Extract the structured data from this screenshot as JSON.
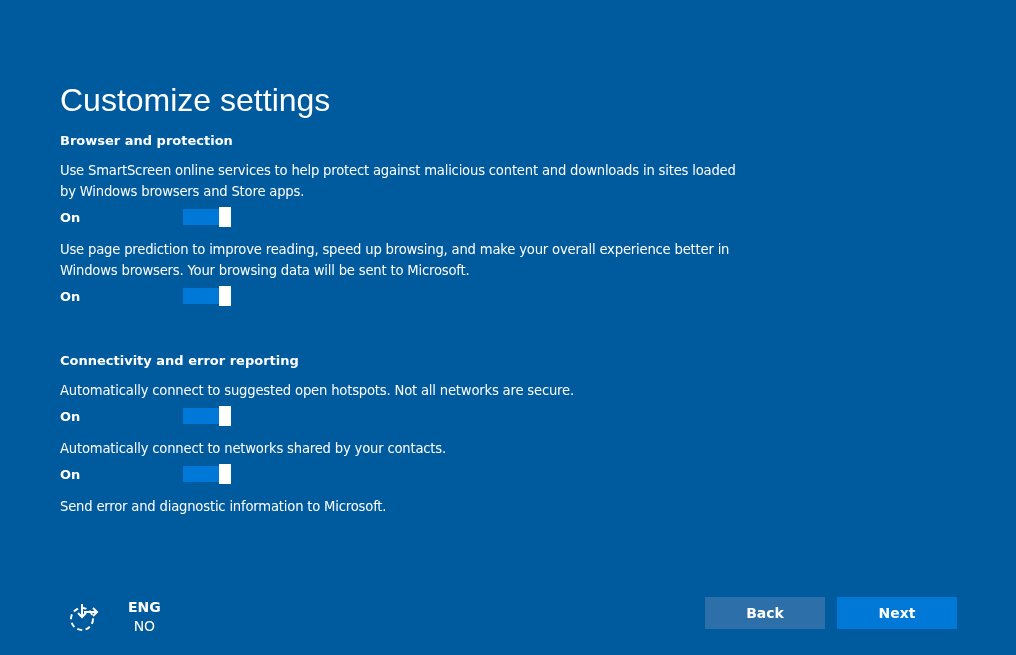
{
  "title": "Customize settings",
  "sections": [
    {
      "heading": "Browser and protection",
      "items": [
        {
          "kind": "toggle",
          "description": "Use SmartScreen online services to help protect against malicious content and downloads in sites loaded by Windows browsers and Store apps.",
          "state_label": "On",
          "on": true
        },
        {
          "kind": "toggle",
          "description": "Use page prediction to improve reading, speed up browsing, and make your overall experience better in Windows browsers. Your browsing data will be sent to Microsoft.",
          "state_label": "On",
          "on": true
        }
      ]
    },
    {
      "heading": "Connectivity and error reporting",
      "items": [
        {
          "kind": "toggle",
          "description": "Automatically connect to suggested open hotspots. Not all networks are secure.",
          "state_label": "On",
          "on": true
        },
        {
          "kind": "toggle",
          "description": "Automatically connect to networks shared by your contacts.",
          "state_label": "On",
          "on": true
        },
        {
          "kind": "text",
          "description": "Send error and diagnostic information to Microsoft."
        }
      ]
    }
  ],
  "footer": {
    "language": "ENG",
    "layout": "NO",
    "buttons": [
      {
        "label": "Back",
        "kind": "secondary"
      },
      {
        "label": "Next",
        "kind": "primary"
      }
    ]
  }
}
